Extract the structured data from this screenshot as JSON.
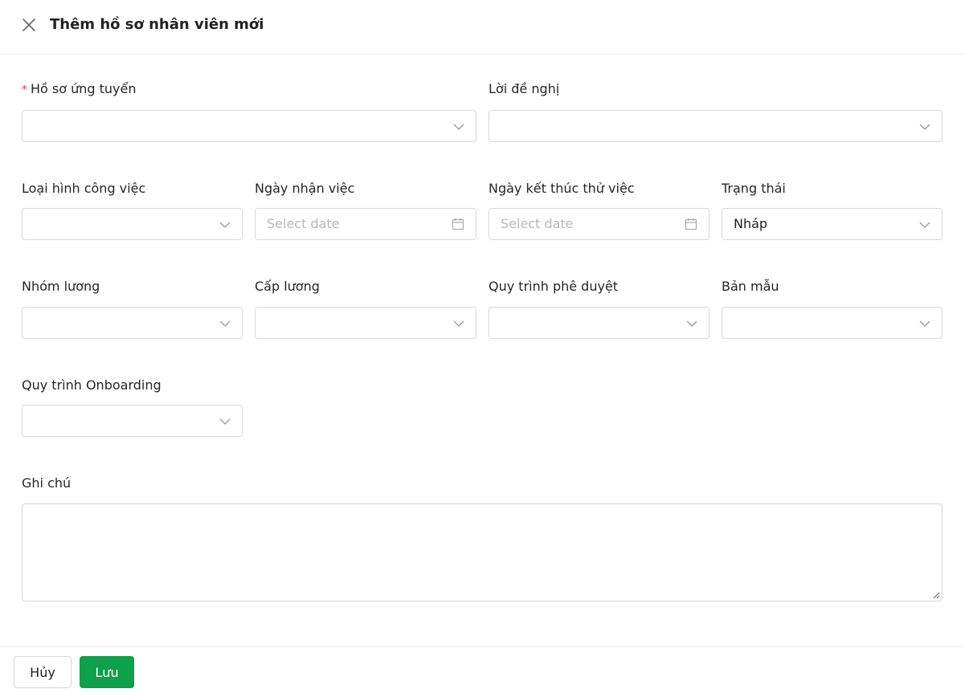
{
  "dialog": {
    "title": "Thêm hồ sơ nhân viên mới"
  },
  "form": {
    "application": {
      "label": "Hồ sơ ứng tuyển",
      "required_marker": "*",
      "value": ""
    },
    "offer": {
      "label": "Lời đề nghị",
      "value": ""
    },
    "job_type": {
      "label": "Loại hình công việc",
      "value": ""
    },
    "start_date": {
      "label": "Ngày nhận việc",
      "placeholder": "Select date"
    },
    "probation_end_date": {
      "label": "Ngày kết thúc thử việc",
      "placeholder": "Select date"
    },
    "status": {
      "label": "Trạng thái",
      "value": "Nháp"
    },
    "salary_group": {
      "label": "Nhóm lương",
      "value": ""
    },
    "salary_grade": {
      "label": "Cấp lương",
      "value": ""
    },
    "approval_process": {
      "label": "Quy trình phê duyệt",
      "value": ""
    },
    "template": {
      "label": "Bản mẫu",
      "value": ""
    },
    "onboarding_process": {
      "label": "Quy trình Onboarding",
      "value": ""
    },
    "notes": {
      "label": "Ghi chú",
      "value": ""
    }
  },
  "footer": {
    "cancel_label": "Hủy",
    "save_label": "Lưu"
  },
  "icons": {
    "close": "close-icon",
    "dropdown": "chevron-down-icon",
    "date": "calendar-icon",
    "resize": "resize-handle-icon"
  },
  "colors": {
    "primary": "#0ea04a",
    "required": "#e5484d",
    "border": "#d9d9d9",
    "placeholder": "#b8b8b8"
  }
}
